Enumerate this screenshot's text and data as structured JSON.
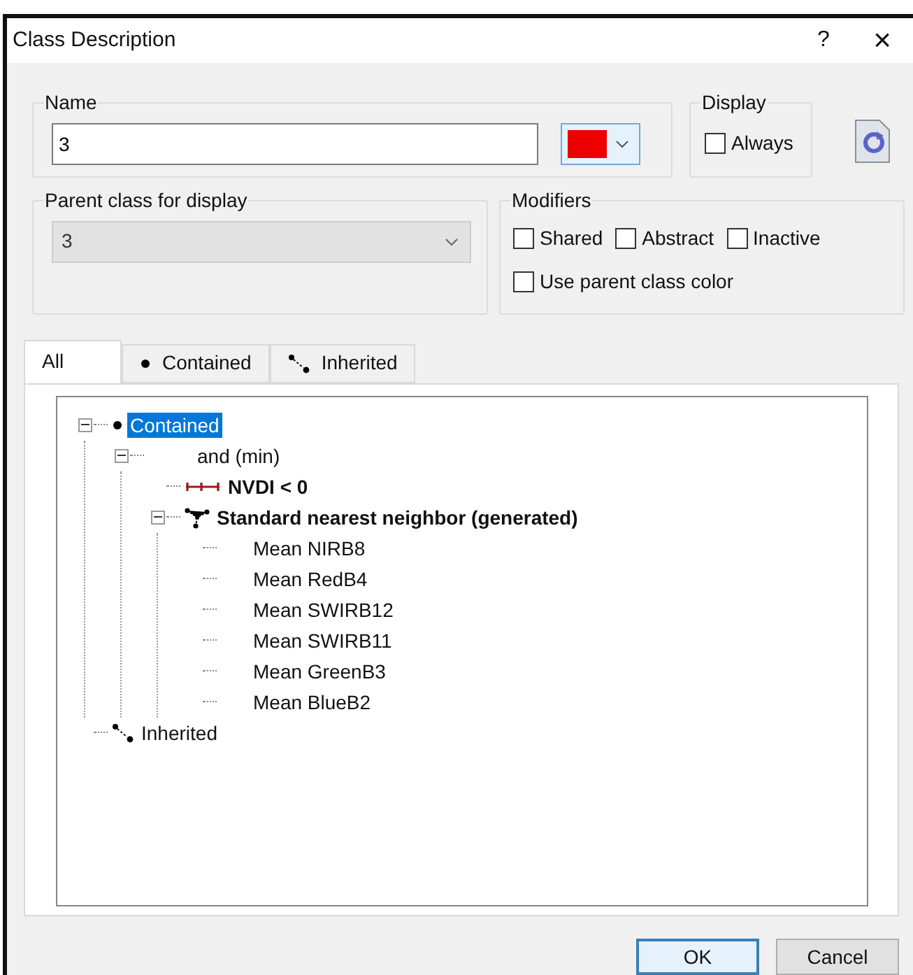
{
  "window": {
    "title": "Class Description",
    "help": "?",
    "close": "×"
  },
  "name_group": {
    "label": "Name",
    "value": "3",
    "color": "#ee0000"
  },
  "display_group": {
    "label": "Display",
    "checkbox": {
      "label": "Always",
      "checked": false
    }
  },
  "parent_group": {
    "label": "Parent class for display",
    "value": "3",
    "disabled": true
  },
  "modifiers": {
    "label": "Modifiers",
    "checkboxes": [
      {
        "label": "Shared",
        "checked": false
      },
      {
        "label": "Abstract",
        "checked": false
      },
      {
        "label": "Inactive",
        "checked": false
      },
      {
        "label": "Use parent class color",
        "checked": false
      }
    ]
  },
  "tabs": [
    {
      "label": "All",
      "kind": "all",
      "selected": true
    },
    {
      "label": "Contained",
      "kind": "contained",
      "selected": false
    },
    {
      "label": "Inherited",
      "kind": "inherited",
      "selected": false
    }
  ],
  "tree": [
    {
      "label": "Contained",
      "kind": "contained",
      "selected": true,
      "bold": false,
      "expanded": true,
      "children": [
        {
          "label": "and (min)",
          "kind": "operator",
          "selected": false,
          "bold": false,
          "expanded": true,
          "children": [
            {
              "label": "NVDI < 0",
              "kind": "threshold",
              "selected": false,
              "bold": true
            },
            {
              "label": "Standard nearest neighbor (generated)",
              "kind": "neighbor",
              "selected": false,
              "bold": true,
              "expanded": true,
              "children": [
                {
                  "label": "Mean NIRB8",
                  "kind": "feature",
                  "selected": false,
                  "bold": false
                },
                {
                  "label": "Mean RedB4",
                  "kind": "feature",
                  "selected": false,
                  "bold": false
                },
                {
                  "label": "Mean SWIRB12",
                  "kind": "feature",
                  "selected": false,
                  "bold": false
                },
                {
                  "label": "Mean SWIRB11",
                  "kind": "feature",
                  "selected": false,
                  "bold": false
                },
                {
                  "label": "Mean GreenB3",
                  "kind": "feature",
                  "selected": false,
                  "bold": false
                },
                {
                  "label": "Mean BlueB2",
                  "kind": "feature",
                  "selected": false,
                  "bold": false
                }
              ]
            }
          ]
        }
      ]
    },
    {
      "label": "Inherited",
      "kind": "inherited",
      "selected": false,
      "bold": false
    }
  ],
  "buttons": [
    {
      "label": "OK",
      "kind": "default"
    },
    {
      "label": "Cancel",
      "kind": "normal"
    }
  ]
}
